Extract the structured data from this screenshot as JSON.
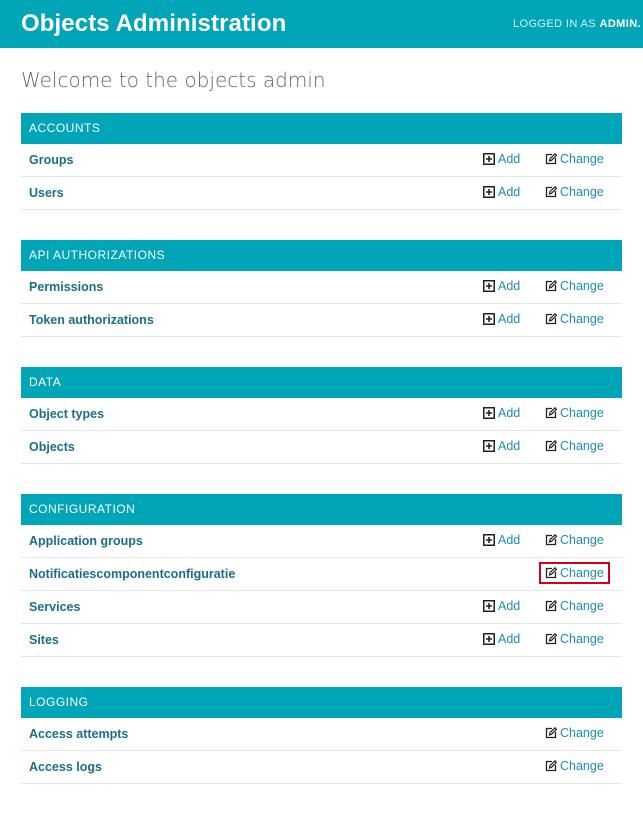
{
  "header": {
    "title": "Objects Administration",
    "logged_in_prefix": "LOGGED IN AS",
    "username": "ADMIN."
  },
  "welcome": "Welcome to the objects admin",
  "labels": {
    "add": "Add",
    "change": "Change"
  },
  "modules": [
    {
      "name": "ACCOUNTS",
      "rows": [
        {
          "name": "Groups",
          "add": true
        },
        {
          "name": "Users",
          "add": true
        }
      ]
    },
    {
      "name": "API AUTHORIZATIONS",
      "rows": [
        {
          "name": "Permissions",
          "add": true
        },
        {
          "name": "Token authorizations",
          "add": true
        }
      ]
    },
    {
      "name": "DATA",
      "rows": [
        {
          "name": "Object types",
          "add": true
        },
        {
          "name": "Objects",
          "add": true
        }
      ]
    },
    {
      "name": "CONFIGURATION",
      "rows": [
        {
          "name": "Application groups",
          "add": true
        },
        {
          "name": "Notificatiescomponentconfiguratie",
          "add": false,
          "highlight": true,
          "name_weight": "normal"
        },
        {
          "name": "Services",
          "add": true
        },
        {
          "name": "Sites",
          "add": true
        }
      ]
    },
    {
      "name": "LOGGING",
      "rows": [
        {
          "name": "Access attempts",
          "add": false
        },
        {
          "name": "Access logs",
          "add": false
        }
      ]
    }
  ],
  "colors": {
    "brand": "#00a5b8",
    "link": "#1a8fb0",
    "highlight": "#d0021b"
  },
  "icons": {
    "add": "plus-square-icon",
    "change": "edit-icon"
  }
}
